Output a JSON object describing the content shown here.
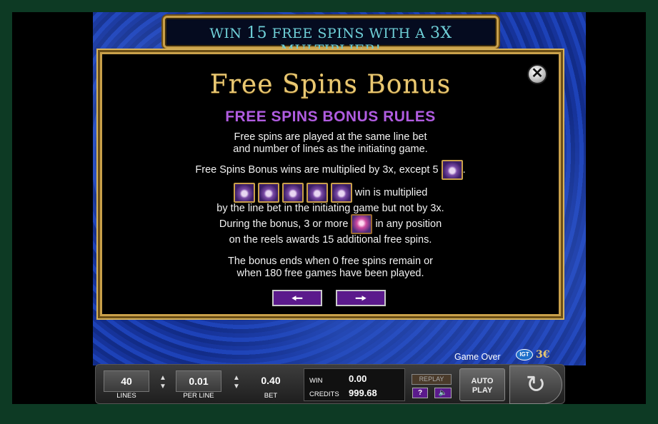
{
  "banner": {
    "text_before": "Win",
    "number": "15",
    "text_after": "free spins with a",
    "multiplier": "3X",
    "text_end": "multiplier!"
  },
  "panel": {
    "title": "Free Spins Bonus",
    "subtitle": "FREE SPINS BONUS RULES",
    "rule1_line1": "Free spins are played at the same line bet",
    "rule1_line2": "and number of lines as the initiating game.",
    "rule2_part1": "Free Spins Bonus wins are multiplied by 3x, except 5",
    "rule2_part1_end": ".",
    "rule2_part2": "win is multiplied",
    "rule2_line3": "by the line bet in the initiating game but not by 3x.",
    "rule3_part1": "During the bonus, 3 or more",
    "rule3_part2": "in any position",
    "rule3_line2": "on the reels awards 15 additional free spins.",
    "rule4_line1": "The bonus ends when 0 free spins remain or",
    "rule4_line2": "when 180 free games have been played.",
    "prev_icon": "left-arrow-icon",
    "next_icon": "right-arrow-icon",
    "close_icon": "close-icon"
  },
  "status": {
    "game_over": "Game Over",
    "igt_logo": "IGT"
  },
  "controls": {
    "lines_value": "40",
    "lines_label": "LINES",
    "per_line_value": "0.01",
    "per_line_label": "PER LINE",
    "bet_value": "0.40",
    "bet_label": "BET",
    "win_label": "WIN",
    "win_value": "0.00",
    "credits_label": "CREDITS",
    "credits_value": "999.68",
    "replay_label": "REPLAY",
    "help_label": "?",
    "sound_icon": "speaker-icon",
    "autoplay_label_1": "AUTO",
    "autoplay_label_2": "PLAY",
    "spin_icon": "spin-icon"
  }
}
